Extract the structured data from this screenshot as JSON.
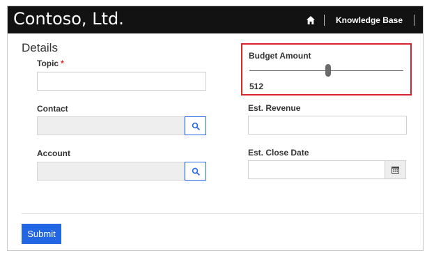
{
  "header": {
    "brand": "Contoso, Ltd.",
    "nav_link": "Knowledge Base",
    "home_icon": "home-icon",
    "background": "#121212"
  },
  "form": {
    "section_title": "Details",
    "topic": {
      "label": "Topic",
      "required_marker": "*",
      "value": ""
    },
    "contact": {
      "label": "Contact",
      "value": "",
      "lookup_icon": "search-icon"
    },
    "account": {
      "label": "Account",
      "value": "",
      "lookup_icon": "search-icon"
    },
    "budget_amount": {
      "label": "Budget Amount",
      "value": "512",
      "slider_fraction": 0.51
    },
    "est_revenue": {
      "label": "Est. Revenue",
      "value": ""
    },
    "est_close_date": {
      "label": "Est. Close Date",
      "value": "",
      "calendar_icon": "calendar-icon"
    },
    "submit_label": "Submit"
  },
  "colors": {
    "accent": "#2266e3",
    "highlight_border": "#d9222a",
    "required": "#e0282e"
  }
}
